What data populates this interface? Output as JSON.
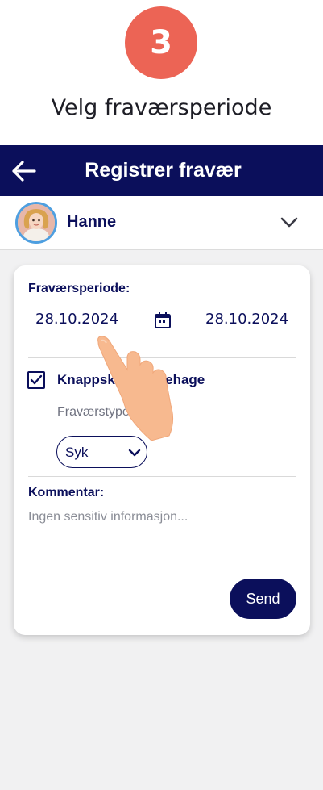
{
  "step": {
    "number": "3",
    "title": "Velg fraværsperiode",
    "color": "#ec6455"
  },
  "header": {
    "title": "Registrer fravær",
    "back_icon": "arrow-left-icon",
    "background": "#0b0f5b"
  },
  "child": {
    "name": "Hanne",
    "avatar": "child-photo",
    "chevron_icon": "chevron-down-icon"
  },
  "form": {
    "period_label": "Fraværsperiode:",
    "date_from": "28.10.2024",
    "date_to": "28.10.2024",
    "calendar_icon": "calendar-icon",
    "kindergarten": {
      "checked": true,
      "name": "Knappskog barnehage"
    },
    "absence_type_label": "Fraværstype",
    "absence_type_value": "Syk",
    "comment_label": "Kommentar:",
    "comment_placeholder": "Ingen sensitiv informasjon...",
    "send_label": "Send"
  },
  "overlay": {
    "pointer_icon": "tap-hand-icon"
  }
}
